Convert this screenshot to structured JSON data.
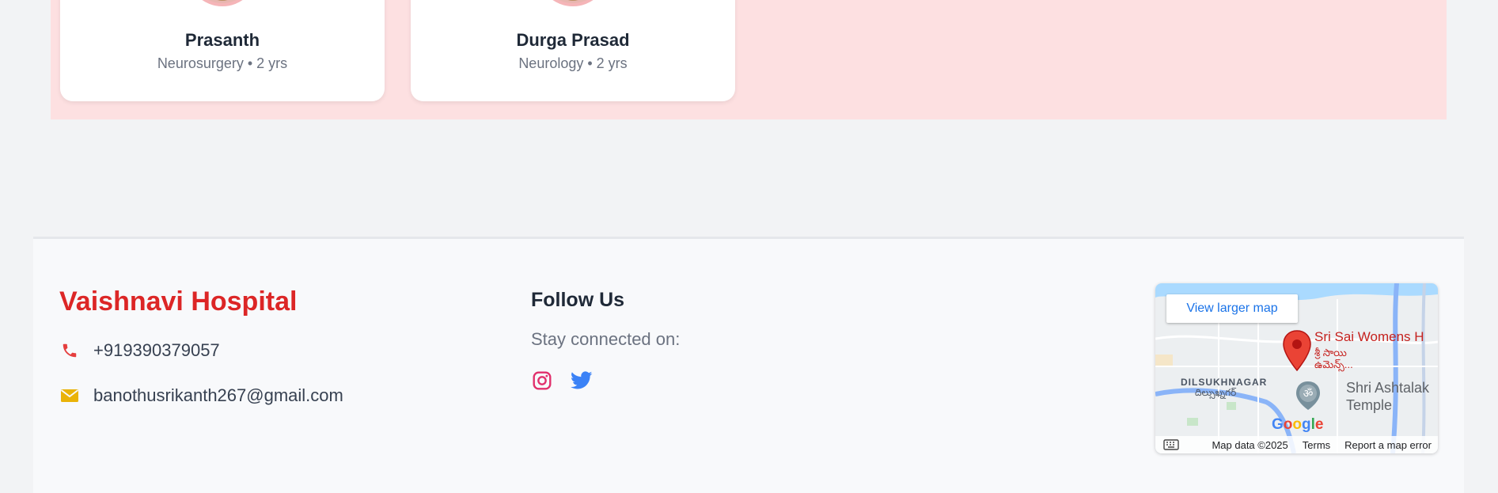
{
  "doctors": [
    {
      "name": "Prasanth",
      "specialty": "Neurosurgery",
      "experience": "2 yrs",
      "meta": "Neurosurgery • 2 yrs"
    },
    {
      "name": "Durga Prasad",
      "specialty": "Neurology",
      "experience": "2 yrs",
      "meta": "Neurology • 2 yrs"
    }
  ],
  "footer": {
    "brand": "Vaishnavi Hospital",
    "phone": "+919390379057",
    "email": "banothusrikanth267@gmail.com",
    "follow_title": "Follow Us",
    "follow_sub": "Stay connected on:",
    "social": [
      {
        "name": "instagram-icon",
        "color": "#e1306c"
      },
      {
        "name": "twitter-icon",
        "color": "#3b82f6"
      }
    ]
  },
  "map": {
    "view_larger": "View larger map",
    "place_name": "Sri Sai Womens H",
    "place_sub_1": "శ్రీ సాయి",
    "place_sub_2": "ఉమెన్స్...",
    "area": "DILSUKHNAGAR",
    "area_local": "దిల్సుఖ్నగర్",
    "temple_line1": "Shri Ashtalak",
    "temple_line2": "Temple",
    "google": "Google",
    "map_data": "Map data ©2025",
    "terms": "Terms",
    "report": "Report a map error"
  },
  "colors": {
    "brand_red": "#dc2626",
    "phone_icon": "#e53e3e",
    "email_icon": "#eab308",
    "band": "#fde0e1"
  }
}
